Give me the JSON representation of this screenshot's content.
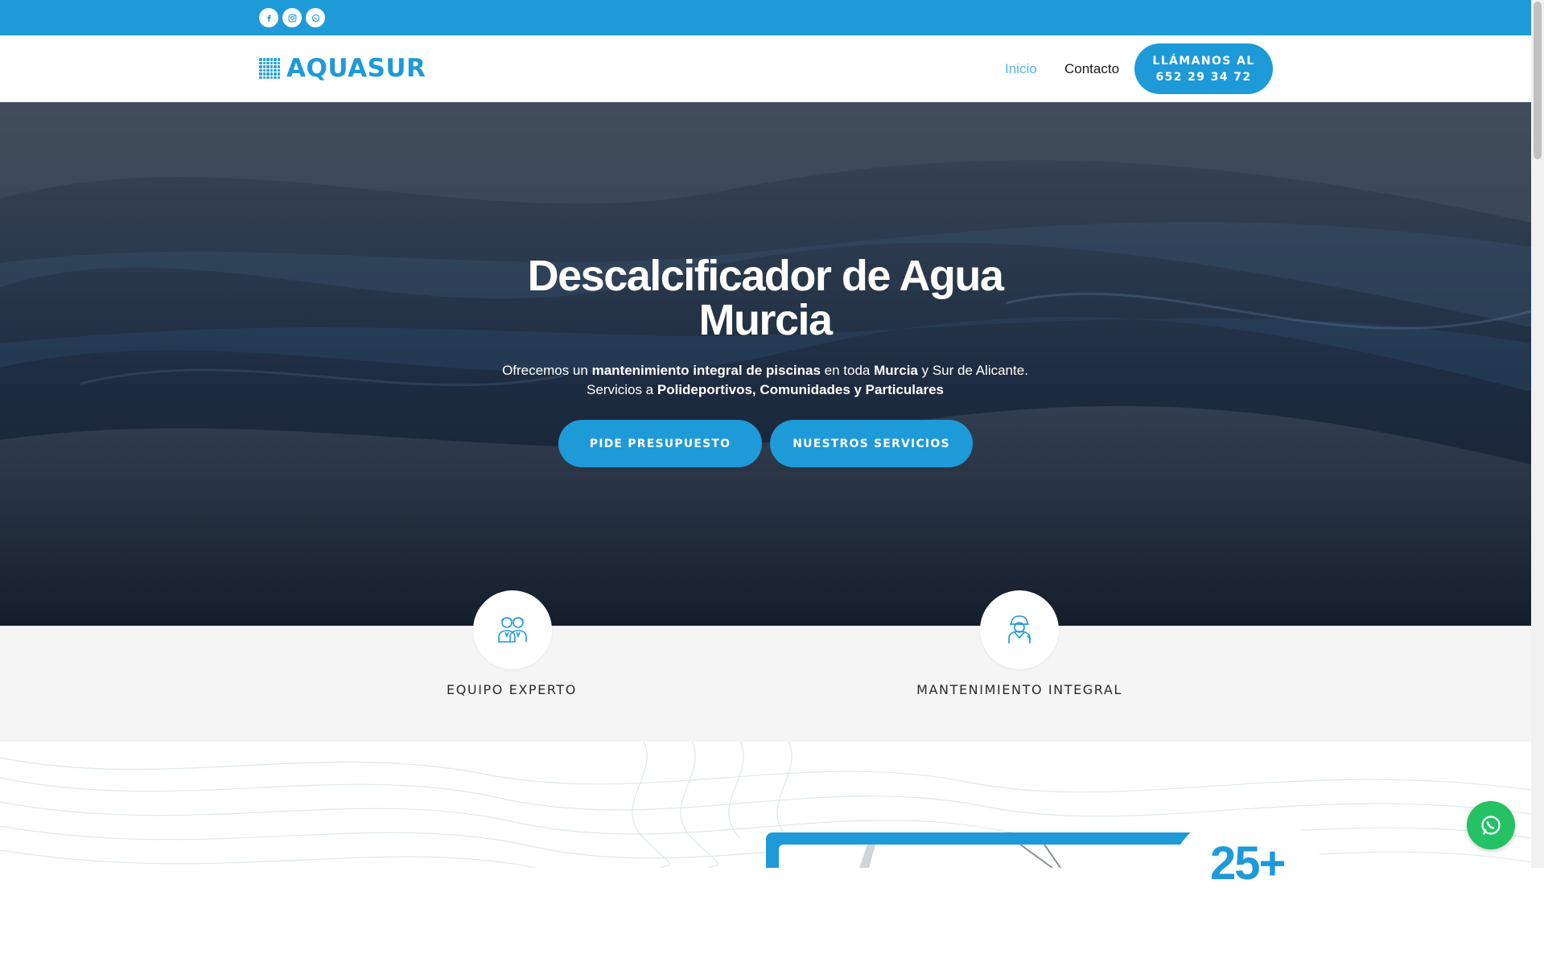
{
  "topbar": {
    "social": [
      {
        "icon": "facebook-icon"
      },
      {
        "icon": "instagram-icon"
      },
      {
        "icon": "whatsapp-icon"
      }
    ]
  },
  "header": {
    "logo_text": "AQUASUR",
    "nav": [
      {
        "label": "Inicio",
        "active": true
      },
      {
        "label": "Contacto",
        "active": false
      }
    ],
    "call_button": {
      "line1": "LLÁMANOS AL",
      "line2": "652 29 34 72"
    }
  },
  "hero": {
    "title_line1": "Descalcificador de Agua",
    "title_line2": "Murcia",
    "subtitle": {
      "p1": "Ofrecemos un ",
      "b1": "mantenimiento integral de piscinas",
      "p2": " en toda ",
      "b2": "Murcia",
      "p3": " y Sur de Alicante.",
      "p4": "Servicios a ",
      "b3": "Polideportivos, Comunidades y Particulares"
    },
    "buttons": {
      "primary": "PIDE PRESUPUESTO",
      "secondary": "NUESTROS SERVICIOS"
    }
  },
  "features": [
    {
      "label": "EQUIPO EXPERTO",
      "icon": "team-icon"
    },
    {
      "label": "MANTENIMIENTO INTEGRAL",
      "icon": "worker-icon"
    }
  ],
  "stats": {
    "partial_number": "25+"
  },
  "colors": {
    "brand": "#1e9ad8",
    "whatsapp": "#25c265",
    "hero_dark": "#1c2b3f"
  }
}
